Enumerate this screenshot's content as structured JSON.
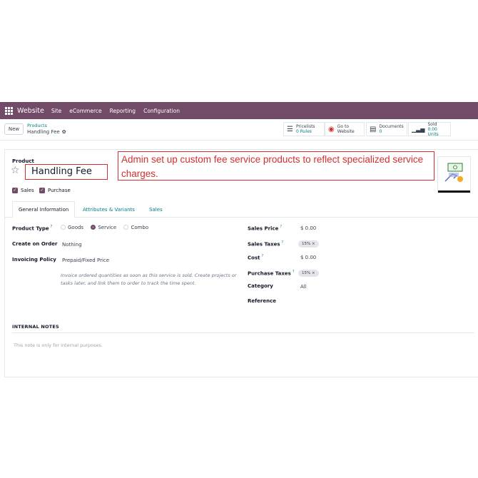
{
  "navbar": {
    "app_name": "Website",
    "menu": [
      "Site",
      "eCommerce",
      "Reporting",
      "Configuration"
    ]
  },
  "control": {
    "new_label": "New",
    "breadcrumb_parent": "Products",
    "breadcrumb_current": "Handling Fee",
    "smart_buttons": [
      {
        "icon": "list-icon",
        "label": "Pricelists",
        "value": "0 Rules"
      },
      {
        "icon": "globe-icon",
        "label": "Go to",
        "value": "Website"
      },
      {
        "icon": "document-icon",
        "label": "Documents",
        "value": "0"
      },
      {
        "icon": "bar-chart-icon",
        "label": "Sold",
        "value": "0.00 Units"
      }
    ]
  },
  "form": {
    "product_label": "Product",
    "product_name": "Handling Fee",
    "annotation": "Admin set up custom fee service products to reflect specialized service charges.",
    "checkboxes": [
      "Sales",
      "Purchase"
    ],
    "tabs": [
      "General Information",
      "Attributes & Variants",
      "Sales"
    ],
    "left": {
      "product_type_label": "Product Type",
      "product_type_options": [
        "Goods",
        "Service",
        "Combo"
      ],
      "product_type_selected": "Service",
      "create_on_order_label": "Create on Order",
      "create_on_order_value": "Nothing",
      "invoicing_policy_label": "Invoicing Policy",
      "invoicing_policy_value": "Prepaid/Fixed Price",
      "invoicing_hint": "Invoice ordered quantities as soon as this service is sold. Create projects or tasks later, and link them to order to track the time spent."
    },
    "right": {
      "sales_price_label": "Sales Price",
      "sales_price_value": "$ 0.00",
      "sales_taxes_label": "Sales Taxes",
      "sales_taxes_tag": "15% ×",
      "cost_label": "Cost",
      "cost_value": "$ 0.00",
      "purchase_taxes_label": "Purchase Taxes",
      "purchase_taxes_tag": "15% ×",
      "category_label": "Category",
      "category_value": "All",
      "reference_label": "Reference"
    },
    "notes_title": "INTERNAL NOTES",
    "notes_placeholder": "This note is only for internal purposes.",
    "help_mark": "?"
  },
  "colors": {
    "brand": "#714b67",
    "link": "#017e84",
    "annotation": "#d32f2f"
  }
}
